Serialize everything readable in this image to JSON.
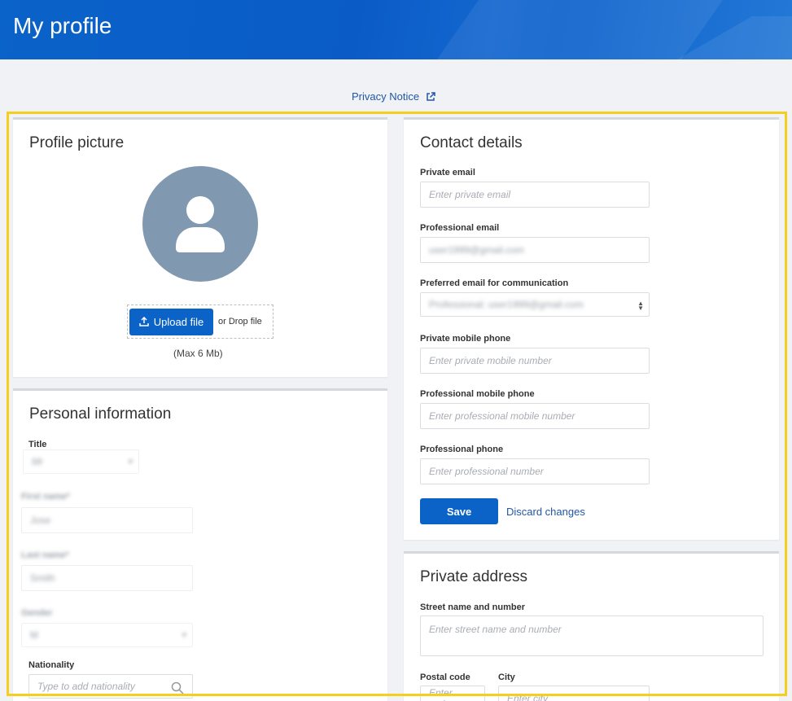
{
  "header": {
    "title": "My profile"
  },
  "privacy": {
    "label": "Privacy Notice",
    "icon": "external-link-icon"
  },
  "profile_picture": {
    "title": "Profile picture",
    "upload_label": "Upload file",
    "drop_label": "or Drop file",
    "max_size": "(Max 6 Mb)"
  },
  "personal_info": {
    "title": "Personal information",
    "title_label": "Title",
    "title_value": "Mr",
    "first_name_label": "First name*",
    "first_name_value": "Jose",
    "last_name_label": "Last name*",
    "last_name_value": "Smith",
    "gender_label": "Gender",
    "gender_value": "M",
    "nationality_label": "Nationality",
    "nationality_placeholder": "Type to add nationality"
  },
  "contact": {
    "title": "Contact details",
    "private_email_label": "Private email",
    "private_email_placeholder": "Enter private email",
    "professional_email_label": "Professional email",
    "professional_email_value": "user1999@gmail.com",
    "preferred_email_label": "Preferred email for communication",
    "preferred_email_value": "Professional: user1999@gmail.com",
    "private_mobile_label": "Private mobile phone",
    "private_mobile_placeholder": "Enter private mobile number",
    "professional_mobile_label": "Professional mobile phone",
    "professional_mobile_placeholder": "Enter professional mobile number",
    "professional_phone_label": "Professional phone",
    "professional_phone_placeholder": "Enter professional number",
    "save_label": "Save",
    "discard_label": "Discard changes"
  },
  "address": {
    "title": "Private address",
    "street_label": "Street name and number",
    "street_placeholder": "Enter street name and number",
    "postal_label": "Postal code",
    "postal_placeholder": "Enter code",
    "city_label": "City",
    "city_placeholder": "Enter city"
  },
  "colors": {
    "primary": "#0b63c8",
    "link": "#2156a5",
    "highlight": "#f5cf1c",
    "avatar": "#8099b1"
  }
}
